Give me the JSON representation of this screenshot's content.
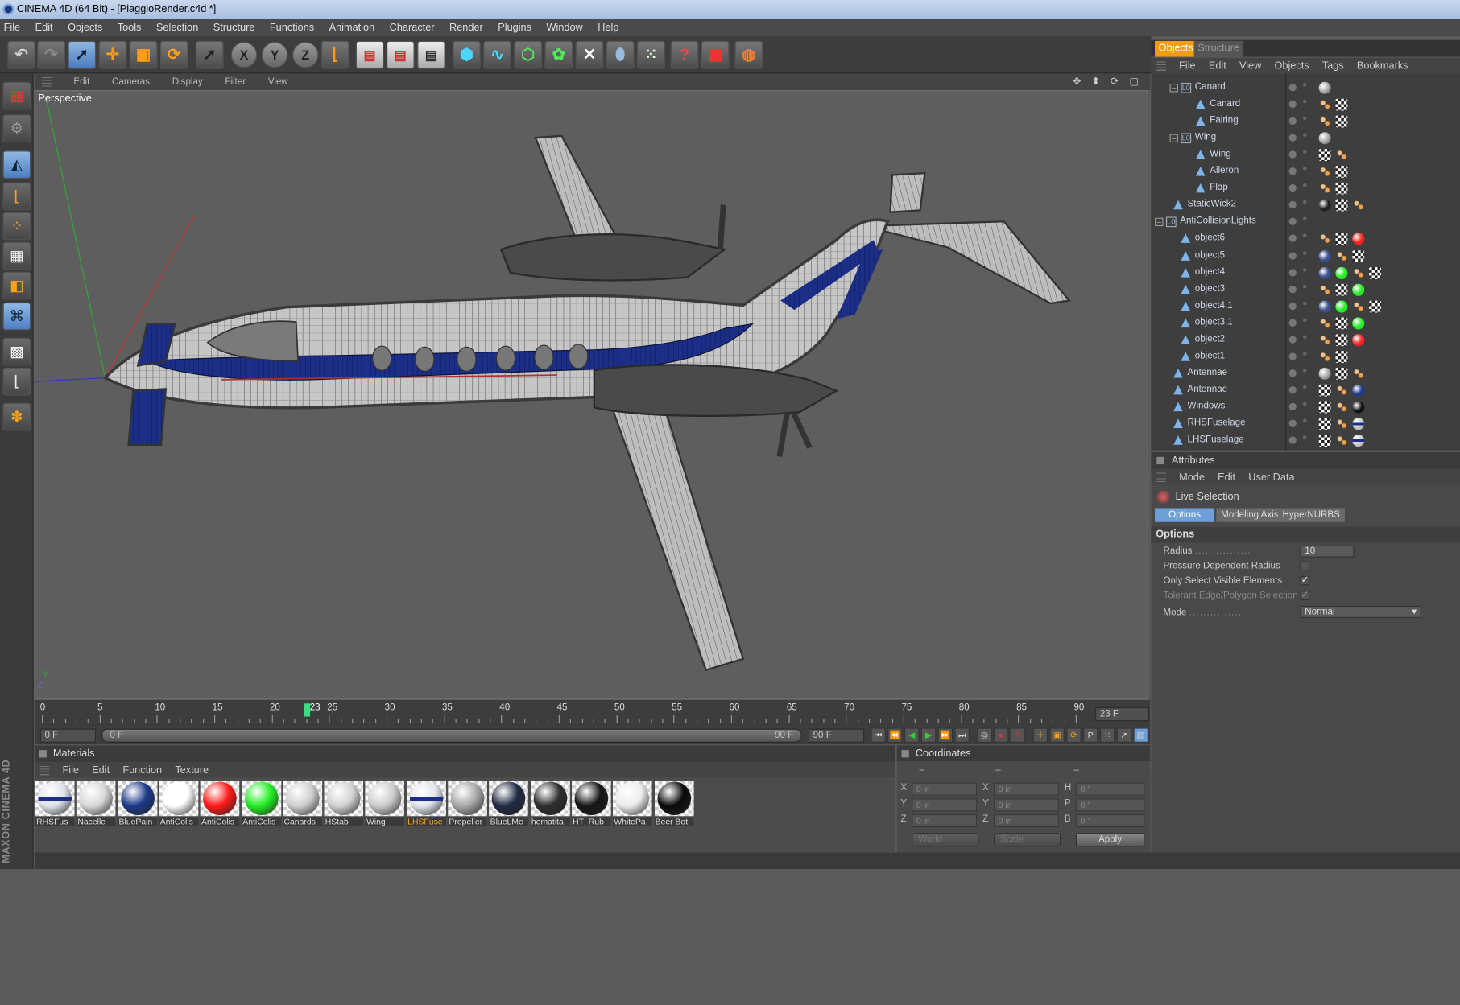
{
  "window": {
    "title": "CINEMA 4D (64 Bit) - [PiaggioRender.c4d *]"
  },
  "menu": [
    "File",
    "Edit",
    "Objects",
    "Tools",
    "Selection",
    "Structure",
    "Functions",
    "Animation",
    "Character",
    "Render",
    "Plugins",
    "Window",
    "Help"
  ],
  "viewport": {
    "menu": [
      "Edit",
      "Cameras",
      "Display",
      "Filter",
      "View"
    ],
    "label": "Perspective",
    "nav_icons": "✥ ⬍ ⟳ ▢"
  },
  "toolbar_icons": [
    "undo-icon",
    "redo-icon",
    "live-selection-icon",
    "move-icon",
    "scale-icon",
    "rotate-icon",
    "last-tool-icon",
    "x-axis-icon",
    "y-axis-icon",
    "z-axis-icon",
    "coordinate-system-icon",
    "render-view-icon",
    "render-picture-viewer-icon",
    "edit-render-settings-icon",
    "cube-icon",
    "spline-icon",
    "nurbs-icon",
    "array-icon",
    "deformer-icon",
    "scene-icon",
    "environment-icon",
    "help-icon",
    "settings-icon",
    "web-icon"
  ],
  "axis_letters": {
    "x": "X",
    "y": "Y",
    "z": "Z"
  },
  "timeline": {
    "ticks": [
      "0",
      "5",
      "10",
      "15",
      "20",
      "25",
      "30",
      "35",
      "40",
      "45",
      "50",
      "55",
      "60",
      "65",
      "70",
      "75",
      "80",
      "85",
      "90"
    ],
    "current_marker": "23",
    "current_frame_display": "23 F",
    "start_frame": "0 F",
    "slider_start": "0 F",
    "slider_end": "90 F",
    "end_frame": "90 F",
    "current": 23,
    "max": 90
  },
  "materials": {
    "title": "Materials",
    "menu": [
      "File",
      "Edit",
      "Function",
      "Texture"
    ],
    "items": [
      {
        "name": "RHSFus",
        "color": "#dfe3ea",
        "stripe": true
      },
      {
        "name": "Nacelle",
        "color": "#d8d8d8"
      },
      {
        "name": "BluePain",
        "color": "#1c3a8a"
      },
      {
        "name": "AntiColis",
        "color": "#ffffff"
      },
      {
        "name": "AntiColis",
        "color": "#ff1a1a"
      },
      {
        "name": "AntiColis",
        "color": "#22ee22"
      },
      {
        "name": "Canards",
        "color": "#cfcfcf"
      },
      {
        "name": "HStab",
        "color": "#d2d2d2"
      },
      {
        "name": "Wing",
        "color": "#cccccc"
      },
      {
        "name": "LHSFuse",
        "color": "#e2e6ee",
        "stripe": true,
        "selected": true
      },
      {
        "name": "Propeller",
        "color": "#a8a8a8"
      },
      {
        "name": "BlueLMe",
        "color": "#222b45"
      },
      {
        "name": "hematita",
        "color": "#2e2e2e"
      },
      {
        "name": "HT_Rub",
        "color": "#151515"
      },
      {
        "name": "WhitePa",
        "color": "#ececec"
      },
      {
        "name": "Beer Bot",
        "color": "#0a0a0a"
      }
    ]
  },
  "coordinates": {
    "title": "Coordinates",
    "col_headers": [
      "–",
      "–",
      "–"
    ],
    "rows": [
      {
        "a": "X",
        "v1": "0 in",
        "b": "X",
        "v2": "0 in",
        "c": "H",
        "v3": "0 °"
      },
      {
        "a": "Y",
        "v1": "0 in",
        "b": "Y",
        "v2": "0 in",
        "c": "P",
        "v3": "0 °"
      },
      {
        "a": "Z",
        "v1": "0 in",
        "b": "Z",
        "v2": "0 in",
        "c": "B",
        "v3": "0 °"
      }
    ],
    "world": "World",
    "scale": "Scale",
    "apply": "Apply"
  },
  "object_manager": {
    "tabs": [
      "Objects",
      "Structure"
    ],
    "menu": [
      "File",
      "Edit",
      "View",
      "Objects",
      "Tags",
      "Bookmarks"
    ],
    "items": [
      {
        "name": "Canard",
        "kind": "null",
        "indent": 3,
        "expand": "-",
        "tags": [
          "mat"
        ]
      },
      {
        "name": "Canard",
        "kind": "poly",
        "indent": 5,
        "tags": [
          "phong",
          "check"
        ]
      },
      {
        "name": "Fairing",
        "kind": "poly",
        "indent": 5,
        "tags": [
          "phong",
          "check"
        ]
      },
      {
        "name": "Wing",
        "kind": "null",
        "indent": 3,
        "expand": "-",
        "tags": [
          "mat"
        ]
      },
      {
        "name": "Wing",
        "kind": "poly",
        "indent": 5,
        "tags": [
          "check",
          "phong"
        ]
      },
      {
        "name": "Aileron",
        "kind": "poly",
        "indent": 5,
        "tags": [
          "phong",
          "check"
        ]
      },
      {
        "name": "Flap",
        "kind": "poly",
        "indent": 5,
        "tags": [
          "phong",
          "check"
        ]
      },
      {
        "name": "StaticWick2",
        "kind": "poly",
        "indent": 2,
        "tags": [
          "dark",
          "check",
          "phong"
        ]
      },
      {
        "name": "AntiCollisionLights",
        "kind": "null",
        "indent": 1,
        "expand": "-",
        "tags": []
      },
      {
        "name": "object6",
        "kind": "poly",
        "indent": 3,
        "tags": [
          "phong",
          "check",
          "red"
        ]
      },
      {
        "name": "object5",
        "kind": "poly",
        "indent": 3,
        "tags": [
          "blue",
          "phong",
          "check"
        ]
      },
      {
        "name": "object4",
        "kind": "poly",
        "indent": 3,
        "tags": [
          "blue",
          "green",
          "phong",
          "check"
        ]
      },
      {
        "name": "object3",
        "kind": "poly",
        "indent": 3,
        "tags": [
          "phong",
          "check",
          "green"
        ]
      },
      {
        "name": "object4.1",
        "kind": "poly",
        "indent": 3,
        "tags": [
          "blue",
          "green",
          "phong",
          "check"
        ]
      },
      {
        "name": "object3.1",
        "kind": "poly",
        "indent": 3,
        "tags": [
          "phong",
          "check",
          "green"
        ]
      },
      {
        "name": "object2",
        "kind": "poly",
        "indent": 3,
        "tags": [
          "phong",
          "check",
          "red"
        ]
      },
      {
        "name": "object1",
        "kind": "poly",
        "indent": 3,
        "tags": [
          "phong",
          "check"
        ]
      },
      {
        "name": "Antennae",
        "kind": "poly",
        "indent": 2,
        "tags": [
          "mat",
          "check",
          "phong"
        ]
      },
      {
        "name": "Antennae",
        "kind": "poly",
        "indent": 2,
        "tags": [
          "check",
          "phong",
          "navy"
        ]
      },
      {
        "name": "Windows",
        "kind": "poly",
        "indent": 2,
        "tags": [
          "check",
          "phong",
          "black"
        ]
      },
      {
        "name": "RHSFuselage",
        "kind": "poly",
        "indent": 2,
        "tags": [
          "check",
          "phong",
          "stripe"
        ]
      },
      {
        "name": "LHSFuselage",
        "kind": "poly",
        "indent": 2,
        "tags": [
          "check",
          "phong",
          "stripe"
        ]
      }
    ]
  },
  "attributes": {
    "title": "Attributes",
    "menu": [
      "Mode",
      "Edit",
      "User Data"
    ],
    "tool": "Live Selection",
    "tabs": [
      "Options",
      "Modeling Axis",
      "HyperNURBS"
    ],
    "section": "Options",
    "radius_label": "Radius",
    "radius_value": "10",
    "pressure_label": "Pressure Dependent Radius",
    "visible_label": "Only Select Visible Elements",
    "tolerant_label": "Tolerant Edge/Polygon Selection",
    "mode_label": "Mode",
    "mode_value": "Normal",
    "check": "✓",
    "dots": "................",
    "pressure_checked": false,
    "visible_checked": true,
    "tolerant_checked": true
  },
  "branding": "MAXON CINEMA 4D",
  "colors": {
    "accent": "#f39c12",
    "selection": "#6e9fd6",
    "fuselage_blue": "#1c2f88"
  }
}
